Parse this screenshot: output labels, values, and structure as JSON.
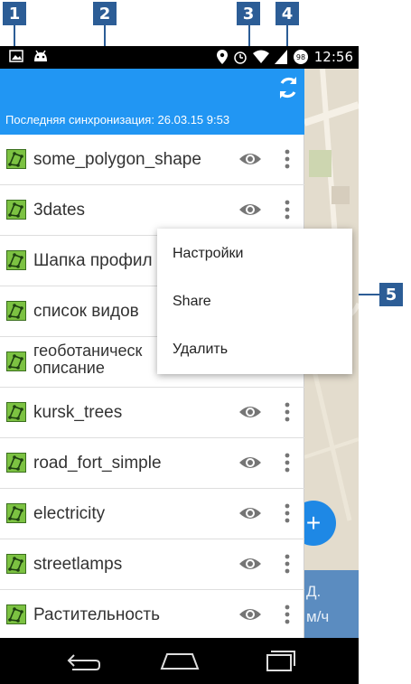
{
  "callouts": [
    "1",
    "2",
    "3",
    "4",
    "5"
  ],
  "status_bar": {
    "time": "12:56",
    "battery": "98"
  },
  "toolbar": {
    "sync_text": "Последняя синхронизация: 26.03.15 9:53"
  },
  "layers": [
    {
      "name": "some_polygon_shape"
    },
    {
      "name": "3dates"
    },
    {
      "name": "Шапка профил"
    },
    {
      "name": "список видов"
    },
    {
      "name": "геоботаническ описание"
    },
    {
      "name": "kursk_trees"
    },
    {
      "name": "road_fort_simple"
    },
    {
      "name": "electricity"
    },
    {
      "name": "streetlamps"
    },
    {
      "name": "Растительность"
    }
  ],
  "context_menu": {
    "settings": "Настройки",
    "share": "Share",
    "delete": "Удалить"
  },
  "map": {
    "info_line1": "Д.",
    "info_line2": "м/ч"
  },
  "colors": {
    "accent": "#2196f3",
    "callout": "#2c5d96",
    "layer_icon": "#7cc242"
  }
}
